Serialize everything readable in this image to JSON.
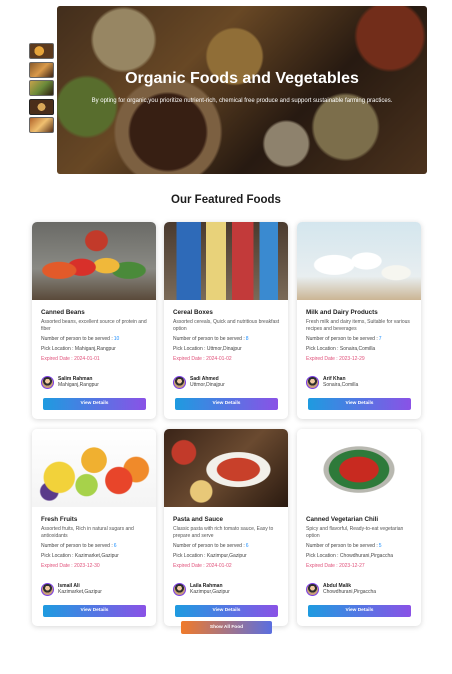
{
  "hero": {
    "title": "Organic Foods and Vegetables",
    "subtitle": "By opting for organic,you prioritize nutrient-rich, chemical free produce and support sustainable farming practices."
  },
  "section_title": "Our Featured Foods",
  "labels": {
    "serve": "Number of person to be served :",
    "pickup": "Pick Location :",
    "expired": "Expired Date :",
    "view_details": "View Details",
    "show_all": "Show All Food"
  },
  "foods": [
    {
      "name": "Canned Beans",
      "description": "Assorted beans, excellent source of protein and fiber",
      "serves": "10",
      "location": "Mahiganj,Rangpur",
      "expired": "2024-01-01",
      "donor": "Salim Rahman",
      "donor_address": "Mahiganj,Rangpur"
    },
    {
      "name": "Cereal Boxes",
      "description": "Assorted cereals, Quick and nutritious breakfast option",
      "serves": "8",
      "location": "Uttmor,Dinajpur",
      "expired": "2024-01-02",
      "donor": "Sadi Ahmed",
      "donor_address": "Uttmor,Dinajpur"
    },
    {
      "name": "Milk and Dairy Products",
      "description": "Fresh milk and dairy items, Suitable for various recipes and beverages",
      "serves": "7",
      "location": "Sonaira,Comilla",
      "expired": "2023-12-29",
      "donor": "Arif Khan",
      "donor_address": "Sonaira,Comilla"
    },
    {
      "name": "Fresh Fruits",
      "description": "Assorted fruits, Rich in natural sugars and antioxidants",
      "serves": "6",
      "location": "Kazimarket,Gazipur",
      "expired": "2023-12-30",
      "donor": "Ismail Ali",
      "donor_address": "Kazimarket,Gazipur"
    },
    {
      "name": "Pasta and Sauce",
      "description": "Classic pasta with rich tomato sauce, Easy to prepare and serve",
      "serves": "6",
      "location": "Kazimpur,Gazipur",
      "expired": "2024-01-02",
      "donor": "Laila Rahman",
      "donor_address": "Kazimpur,Gazipur"
    },
    {
      "name": "Canned Vegetarian Chili",
      "description": "Spicy and flavorful, Ready-to-eat vegetarian option",
      "serves": "5",
      "location": "Chowdhurani,Pirgaccha",
      "expired": "2023-12-27",
      "donor": "Abdul Malik",
      "donor_address": "Chowdhurani,Pirgaccha"
    }
  ]
}
